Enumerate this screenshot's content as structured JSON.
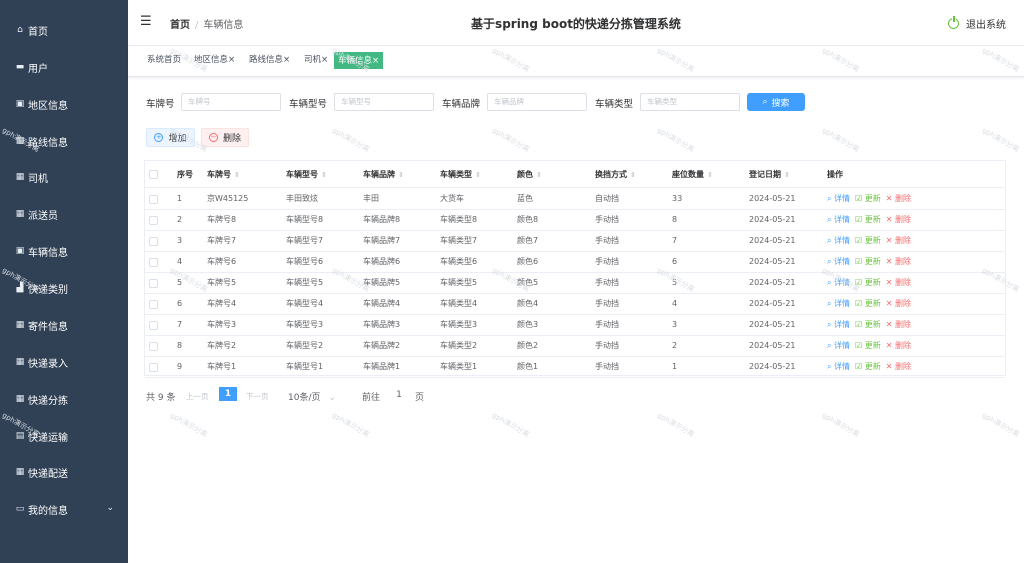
{
  "sidebar": {
    "items": [
      {
        "label": "首页",
        "icon": "home-icon",
        "glyph": "⌂"
      },
      {
        "label": "用户",
        "icon": "chat-icon",
        "glyph": "▬"
      },
      {
        "label": "地区信息",
        "icon": "inbox-icon",
        "glyph": "▣"
      },
      {
        "label": "路线信息",
        "icon": "grid-icon",
        "glyph": "▦"
      },
      {
        "label": "司机",
        "icon": "grid-icon",
        "glyph": "▦"
      },
      {
        "label": "派送员",
        "icon": "grid-icon",
        "glyph": "▦"
      },
      {
        "label": "车辆信息",
        "icon": "document-icon",
        "glyph": "▣"
      },
      {
        "label": "快递类别",
        "icon": "briefcase-icon",
        "glyph": "▟"
      },
      {
        "label": "寄件信息",
        "icon": "grid-icon",
        "glyph": "▦"
      },
      {
        "label": "快递录入",
        "icon": "grid-icon",
        "glyph": "▦"
      },
      {
        "label": "快递分拣",
        "icon": "grid-icon",
        "glyph": "▦"
      },
      {
        "label": "快递运输",
        "icon": "list-icon",
        "glyph": "▤"
      },
      {
        "label": "快递配送",
        "icon": "grid-icon",
        "glyph": "▦"
      },
      {
        "label": "我的信息",
        "icon": "card-icon",
        "glyph": "▭"
      }
    ]
  },
  "header": {
    "home": "首页",
    "current": "车辆信息",
    "title": "基于spring boot的快递分拣管理系统",
    "logout": "退出系统",
    "accent": "#67c23a"
  },
  "tabs": [
    {
      "label": "系统首页",
      "closable": false
    },
    {
      "label": "地区信息",
      "closable": true
    },
    {
      "label": "路线信息",
      "closable": true
    },
    {
      "label": "司机",
      "closable": true
    },
    {
      "label": "车辆信息",
      "closable": true,
      "active": true
    }
  ],
  "search": {
    "plate_label": "车牌号",
    "plate_ph": "车牌号",
    "model_label": "车辆型号",
    "model_ph": "车辆型号",
    "brand_label": "车辆品牌",
    "brand_ph": "车辆品牌",
    "type_label": "车辆类型",
    "type_ph": "车辆类型",
    "button": "搜索"
  },
  "actions": {
    "add": "增加",
    "delete": "删除"
  },
  "table": {
    "headers": [
      "序号",
      "车牌号",
      "车辆型号",
      "车辆品牌",
      "车辆类型",
      "颜色",
      "换挡方式",
      "座位数量",
      "登记日期",
      "操作"
    ],
    "action_labels": {
      "detail": "详情",
      "update": "更新",
      "delete": "删除"
    },
    "rows": [
      [
        "1",
        "京W45125",
        "丰田致炫",
        "丰田",
        "大货车",
        "蓝色",
        "自动挡",
        "33",
        "2024-05-21"
      ],
      [
        "2",
        "车牌号8",
        "车辆型号8",
        "车辆品牌8",
        "车辆类型8",
        "颜色8",
        "手动挡",
        "8",
        "2024-05-21"
      ],
      [
        "3",
        "车牌号7",
        "车辆型号7",
        "车辆品牌7",
        "车辆类型7",
        "颜色7",
        "手动挡",
        "7",
        "2024-05-21"
      ],
      [
        "4",
        "车牌号6",
        "车辆型号6",
        "车辆品牌6",
        "车辆类型6",
        "颜色6",
        "手动挡",
        "6",
        "2024-05-21"
      ],
      [
        "5",
        "车牌号5",
        "车辆型号5",
        "车辆品牌5",
        "车辆类型5",
        "颜色5",
        "手动挡",
        "5",
        "2024-05-21"
      ],
      [
        "6",
        "车牌号4",
        "车辆型号4",
        "车辆品牌4",
        "车辆类型4",
        "颜色4",
        "手动挡",
        "4",
        "2024-05-21"
      ],
      [
        "7",
        "车牌号3",
        "车辆型号3",
        "车辆品牌3",
        "车辆类型3",
        "颜色3",
        "手动挡",
        "3",
        "2024-05-21"
      ],
      [
        "8",
        "车牌号2",
        "车辆型号2",
        "车辆品牌2",
        "车辆类型2",
        "颜色2",
        "手动挡",
        "2",
        "2024-05-21"
      ],
      [
        "9",
        "车牌号1",
        "车辆型号1",
        "车辆品牌1",
        "车辆类型1",
        "颜色1",
        "手动挡",
        "1",
        "2024-05-21"
      ]
    ]
  },
  "pagination": {
    "total": "共 9 条",
    "prev": "上一页",
    "page": "1",
    "next": "下一页",
    "size": "10条/页",
    "goto": "前往",
    "goto_value": "1",
    "page_unit": "页"
  },
  "watermark": "gph演示分离"
}
